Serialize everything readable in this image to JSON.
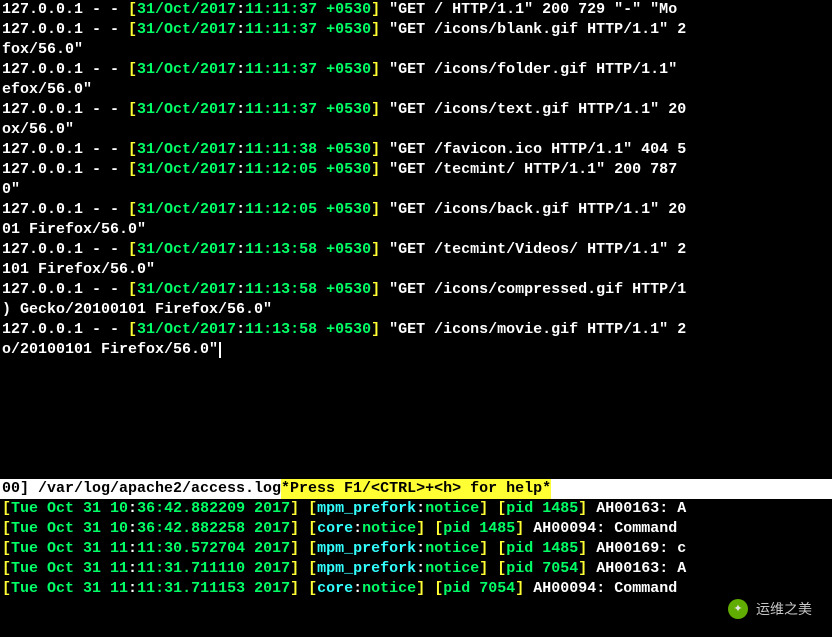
{
  "access_log": {
    "lines": [
      {
        "parts": [
          {
            "t": "127.0.0.1 - - ",
            "c": "w"
          },
          {
            "t": "[",
            "c": "y"
          },
          {
            "t": "31/Oct/2017",
            "c": "g"
          },
          {
            "t": ":",
            "c": "w"
          },
          {
            "t": "11:11:37 +0530",
            "c": "g"
          },
          {
            "t": "]",
            "c": "y"
          },
          {
            "t": " \"GET / HTTP/1.1\" 200 729 \"-\" \"Mo",
            "c": "w"
          }
        ]
      },
      {
        "parts": [
          {
            "t": "127.0.0.1 - - ",
            "c": "w"
          },
          {
            "t": "[",
            "c": "y"
          },
          {
            "t": "31/Oct/2017",
            "c": "g"
          },
          {
            "t": ":",
            "c": "w"
          },
          {
            "t": "11:11:37 +0530",
            "c": "g"
          },
          {
            "t": "]",
            "c": "y"
          },
          {
            "t": " \"GET /icons/blank.gif HTTP/1.1\" 2",
            "c": "w"
          }
        ]
      },
      {
        "parts": [
          {
            "t": "fox/56.0\"",
            "c": "w"
          }
        ]
      },
      {
        "parts": [
          {
            "t": "127.0.0.1 - - ",
            "c": "w"
          },
          {
            "t": "[",
            "c": "y"
          },
          {
            "t": "31/Oct/2017",
            "c": "g"
          },
          {
            "t": ":",
            "c": "w"
          },
          {
            "t": "11:11:37 +0530",
            "c": "g"
          },
          {
            "t": "]",
            "c": "y"
          },
          {
            "t": " \"GET /icons/folder.gif HTTP/1.1\" ",
            "c": "w"
          }
        ]
      },
      {
        "parts": [
          {
            "t": "efox/56.0\"",
            "c": "w"
          }
        ]
      },
      {
        "parts": [
          {
            "t": "127.0.0.1 - - ",
            "c": "w"
          },
          {
            "t": "[",
            "c": "y"
          },
          {
            "t": "31/Oct/2017",
            "c": "g"
          },
          {
            "t": ":",
            "c": "w"
          },
          {
            "t": "11:11:37 +0530",
            "c": "g"
          },
          {
            "t": "]",
            "c": "y"
          },
          {
            "t": " \"GET /icons/text.gif HTTP/1.1\" 20",
            "c": "w"
          }
        ]
      },
      {
        "parts": [
          {
            "t": "ox/56.0\"",
            "c": "w"
          }
        ]
      },
      {
        "parts": [
          {
            "t": "127.0.0.1 - - ",
            "c": "w"
          },
          {
            "t": "[",
            "c": "y"
          },
          {
            "t": "31/Oct/2017",
            "c": "g"
          },
          {
            "t": ":",
            "c": "w"
          },
          {
            "t": "11:11:38 +0530",
            "c": "g"
          },
          {
            "t": "]",
            "c": "y"
          },
          {
            "t": " \"GET /favicon.ico HTTP/1.1\" 404 5",
            "c": "w"
          }
        ]
      },
      {
        "parts": [
          {
            "t": "127.0.0.1 - - ",
            "c": "w"
          },
          {
            "t": "[",
            "c": "y"
          },
          {
            "t": "31/Oct/2017",
            "c": "g"
          },
          {
            "t": ":",
            "c": "w"
          },
          {
            "t": "11:12:05 +0530",
            "c": "g"
          },
          {
            "t": "]",
            "c": "y"
          },
          {
            "t": " \"GET /tecmint/ HTTP/1.1\" 200 787 ",
            "c": "w"
          }
        ]
      },
      {
        "parts": [
          {
            "t": "0\"",
            "c": "w"
          }
        ]
      },
      {
        "parts": [
          {
            "t": "127.0.0.1 - - ",
            "c": "w"
          },
          {
            "t": "[",
            "c": "y"
          },
          {
            "t": "31/Oct/2017",
            "c": "g"
          },
          {
            "t": ":",
            "c": "w"
          },
          {
            "t": "11:12:05 +0530",
            "c": "g"
          },
          {
            "t": "]",
            "c": "y"
          },
          {
            "t": " \"GET /icons/back.gif HTTP/1.1\" 20",
            "c": "w"
          }
        ]
      },
      {
        "parts": [
          {
            "t": "01 Firefox/56.0\"",
            "c": "w"
          }
        ]
      },
      {
        "parts": [
          {
            "t": "127.0.0.1 - - ",
            "c": "w"
          },
          {
            "t": "[",
            "c": "y"
          },
          {
            "t": "31/Oct/2017",
            "c": "g"
          },
          {
            "t": ":",
            "c": "w"
          },
          {
            "t": "11:13:58 +0530",
            "c": "g"
          },
          {
            "t": "]",
            "c": "y"
          },
          {
            "t": " \"GET /tecmint/Videos/ HTTP/1.1\" 2",
            "c": "w"
          }
        ]
      },
      {
        "parts": [
          {
            "t": "101 Firefox/56.0\"",
            "c": "w"
          }
        ]
      },
      {
        "parts": [
          {
            "t": "127.0.0.1 - - ",
            "c": "w"
          },
          {
            "t": "[",
            "c": "y"
          },
          {
            "t": "31/Oct/2017",
            "c": "g"
          },
          {
            "t": ":",
            "c": "w"
          },
          {
            "t": "11:13:58 +0530",
            "c": "g"
          },
          {
            "t": "]",
            "c": "y"
          },
          {
            "t": " \"GET /icons/compressed.gif HTTP/1",
            "c": "w"
          }
        ]
      },
      {
        "parts": [
          {
            "t": ") Gecko/20100101 Firefox/56.0\"",
            "c": "w"
          }
        ]
      },
      {
        "parts": [
          {
            "t": "127.0.0.1 - - ",
            "c": "w"
          },
          {
            "t": "[",
            "c": "y"
          },
          {
            "t": "31/Oct/2017",
            "c": "g"
          },
          {
            "t": ":",
            "c": "w"
          },
          {
            "t": "11:13:58 +0530",
            "c": "g"
          },
          {
            "t": "]",
            "c": "y"
          },
          {
            "t": " \"GET /icons/movie.gif HTTP/1.1\" 2",
            "c": "w"
          }
        ]
      },
      {
        "parts": [
          {
            "t": "o/20100101 Firefox/56.0\"",
            "c": "w"
          }
        ],
        "cursor": true
      }
    ]
  },
  "status": {
    "left": "00] /var/log/apache2/access.log ",
    "help": "*Press F1/<CTRL>+<h> for help*"
  },
  "error_log": {
    "lines": [
      {
        "parts": [
          {
            "t": "[",
            "c": "y"
          },
          {
            "t": "Tue Oct 31 10",
            "c": "g"
          },
          {
            "t": ":",
            "c": "w"
          },
          {
            "t": "36:42.882209 2017",
            "c": "g"
          },
          {
            "t": "]",
            "c": "y"
          },
          {
            "t": " ",
            "c": "w"
          },
          {
            "t": "[",
            "c": "y"
          },
          {
            "t": "mpm_prefork",
            "c": "c"
          },
          {
            "t": ":",
            "c": "w"
          },
          {
            "t": "notice",
            "c": "g"
          },
          {
            "t": "]",
            "c": "y"
          },
          {
            "t": " ",
            "c": "w"
          },
          {
            "t": "[",
            "c": "y"
          },
          {
            "t": "pid 1485",
            "c": "g"
          },
          {
            "t": "]",
            "c": "y"
          },
          {
            "t": " AH00163: A",
            "c": "w"
          }
        ]
      },
      {
        "parts": [
          {
            "t": "[",
            "c": "y"
          },
          {
            "t": "Tue Oct 31 10",
            "c": "g"
          },
          {
            "t": ":",
            "c": "w"
          },
          {
            "t": "36:42.882258 2017",
            "c": "g"
          },
          {
            "t": "]",
            "c": "y"
          },
          {
            "t": " ",
            "c": "w"
          },
          {
            "t": "[",
            "c": "y"
          },
          {
            "t": "core",
            "c": "c"
          },
          {
            "t": ":",
            "c": "w"
          },
          {
            "t": "notice",
            "c": "g"
          },
          {
            "t": "]",
            "c": "y"
          },
          {
            "t": " ",
            "c": "w"
          },
          {
            "t": "[",
            "c": "y"
          },
          {
            "t": "pid 1485",
            "c": "g"
          },
          {
            "t": "]",
            "c": "y"
          },
          {
            "t": " AH00094: Command ",
            "c": "w"
          }
        ]
      },
      {
        "parts": [
          {
            "t": "[",
            "c": "y"
          },
          {
            "t": "Tue Oct 31 11",
            "c": "g"
          },
          {
            "t": ":",
            "c": "w"
          },
          {
            "t": "11:30.572704 2017",
            "c": "g"
          },
          {
            "t": "]",
            "c": "y"
          },
          {
            "t": " ",
            "c": "w"
          },
          {
            "t": "[",
            "c": "y"
          },
          {
            "t": "mpm_prefork",
            "c": "c"
          },
          {
            "t": ":",
            "c": "w"
          },
          {
            "t": "notice",
            "c": "g"
          },
          {
            "t": "]",
            "c": "y"
          },
          {
            "t": " ",
            "c": "w"
          },
          {
            "t": "[",
            "c": "y"
          },
          {
            "t": "pid 1485",
            "c": "g"
          },
          {
            "t": "]",
            "c": "y"
          },
          {
            "t": " AH00169: c",
            "c": "w"
          }
        ]
      },
      {
        "parts": [
          {
            "t": "[",
            "c": "y"
          },
          {
            "t": "Tue Oct 31 11",
            "c": "g"
          },
          {
            "t": ":",
            "c": "w"
          },
          {
            "t": "11:31.711110 2017",
            "c": "g"
          },
          {
            "t": "]",
            "c": "y"
          },
          {
            "t": " ",
            "c": "w"
          },
          {
            "t": "[",
            "c": "y"
          },
          {
            "t": "mpm_prefork",
            "c": "c"
          },
          {
            "t": ":",
            "c": "w"
          },
          {
            "t": "notice",
            "c": "g"
          },
          {
            "t": "]",
            "c": "y"
          },
          {
            "t": " ",
            "c": "w"
          },
          {
            "t": "[",
            "c": "y"
          },
          {
            "t": "pid 7054",
            "c": "g"
          },
          {
            "t": "]",
            "c": "y"
          },
          {
            "t": " AH00163: A",
            "c": "w"
          }
        ]
      },
      {
        "parts": [
          {
            "t": "[",
            "c": "y"
          },
          {
            "t": "Tue Oct 31 11",
            "c": "g"
          },
          {
            "t": ":",
            "c": "w"
          },
          {
            "t": "11:31.711153 2017",
            "c": "g"
          },
          {
            "t": "]",
            "c": "y"
          },
          {
            "t": " ",
            "c": "w"
          },
          {
            "t": "[",
            "c": "y"
          },
          {
            "t": "core",
            "c": "c"
          },
          {
            "t": ":",
            "c": "w"
          },
          {
            "t": "notice",
            "c": "g"
          },
          {
            "t": "]",
            "c": "y"
          },
          {
            "t": " ",
            "c": "w"
          },
          {
            "t": "[",
            "c": "y"
          },
          {
            "t": "pid 7054",
            "c": "g"
          },
          {
            "t": "]",
            "c": "y"
          },
          {
            "t": " AH00094: Command ",
            "c": "w"
          }
        ]
      }
    ]
  },
  "watermark": {
    "text": "运维之美"
  }
}
